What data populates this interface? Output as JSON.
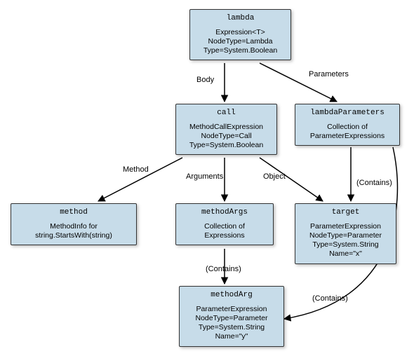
{
  "nodes": {
    "lambda": {
      "title": "lambda",
      "line1": "Expression<T>",
      "line2": "NodeType=Lambda",
      "line3": "Type=System.Boolean"
    },
    "call": {
      "title": "call",
      "line1": "MethodCallExpression",
      "line2": "NodeType=Call",
      "line3": "Type=System.Boolean"
    },
    "lambdaParameters": {
      "title": "lambdaParameters",
      "line1": "Collection of",
      "line2": "ParameterExpressions"
    },
    "method": {
      "title": "method",
      "line1": "MethodInfo for",
      "line2": "string.StartsWith(string)"
    },
    "methodArgs": {
      "title": "methodArgs",
      "line1": "Collection of",
      "line2": "Expressions"
    },
    "target": {
      "title": "target",
      "line1": "ParameterExpression",
      "line2": "NodeType=Parameter",
      "line3": "Type=System.String",
      "line4": "Name=\"x\""
    },
    "methodArg": {
      "title": "methodArg",
      "line1": "ParameterExpression",
      "line2": "NodeType=Parameter",
      "line3": "Type=System.String",
      "line4": "Name=\"y\""
    }
  },
  "edges": {
    "body": "Body",
    "parameters": "Parameters",
    "method": "Method",
    "arguments": "Arguments",
    "object": "Object",
    "contains1": "(Contains)",
    "contains2": "(Contains)",
    "contains3": "(Contains)"
  }
}
